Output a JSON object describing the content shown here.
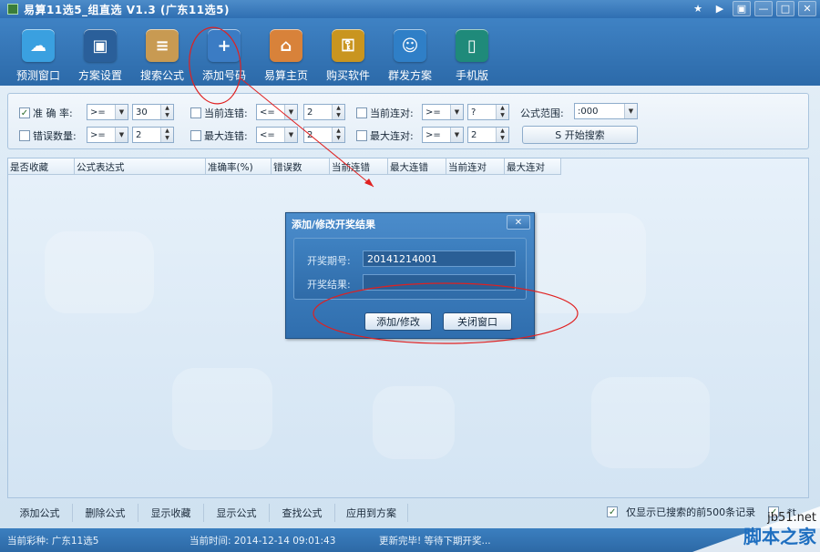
{
  "window": {
    "title": "易算11选5_组直选 V1.3 (广东11选5)",
    "accent": "#2f6fb2"
  },
  "window_controls": [
    "★",
    "▶",
    "▣",
    "—",
    "□",
    "✕"
  ],
  "toolbar": {
    "items": [
      {
        "label": "预测窗口",
        "icon": "cloud-icon",
        "color": "#3aa0e0",
        "glyph": "☁"
      },
      {
        "label": "方案设置",
        "icon": "monitor-icon",
        "color": "#2a5f9a",
        "glyph": "▣"
      },
      {
        "label": "搜索公式",
        "icon": "document-search-icon",
        "color": "#c89a52",
        "glyph": "≡"
      },
      {
        "label": "添加号码",
        "icon": "folder-plus-icon",
        "color": "#3b7cc4",
        "glyph": "+"
      },
      {
        "label": "易算主页",
        "icon": "house-icon",
        "color": "#d8823a",
        "glyph": "⌂"
      },
      {
        "label": "购买软件",
        "icon": "key-icon",
        "color": "#c9951f",
        "glyph": "⚿"
      },
      {
        "label": "群发方案",
        "icon": "users-icon",
        "color": "#2f7fc7",
        "glyph": "☺"
      },
      {
        "label": "手机版",
        "icon": "phone-icon",
        "color": "#1f8a7a",
        "glyph": "▯"
      }
    ]
  },
  "filters": {
    "accuracy": {
      "label": "准 确 率:",
      "checked": true,
      "op": ">=",
      "value": "30"
    },
    "error_count": {
      "label": "错误数量:",
      "checked": false,
      "op": ">=",
      "value": "2"
    },
    "current_miss": {
      "label": "当前连错:",
      "checked": false,
      "op": "<=",
      "value": "2"
    },
    "max_miss": {
      "label": "最大连错:",
      "checked": false,
      "op": "<=",
      "value": "2"
    },
    "current_hit": {
      "label": "当前连对:",
      "checked": false,
      "op": ">=",
      "value": "?"
    },
    "max_hit": {
      "label": "最大连对:",
      "checked": false,
      "op": ">=",
      "value": "2"
    },
    "range_label": "公式范围:",
    "range_value": ":000",
    "search_button": "S 开始搜索"
  },
  "grid": {
    "columns": [
      "是否收藏",
      "公式表达式",
      "准确率(%)",
      "错误数",
      "当前连错",
      "最大连错",
      "当前连对",
      "最大连对"
    ]
  },
  "actions": {
    "buttons": [
      "添加公式",
      "删除公式",
      "显示收藏",
      "显示公式",
      "查找公式",
      "应用到方案"
    ],
    "option1": "仅显示已搜索的前500条记录",
    "option2": "*t"
  },
  "status": {
    "lottery": "当前彩种: 广东11选5",
    "time": "当前时间: 2014-12-14 09:01:43",
    "message": "更新完毕! 等待下期开奖..."
  },
  "dialog": {
    "title": "添加/修改开奖结果",
    "close": "✕",
    "period_label": "开奖期号:",
    "period_value": "20141214001",
    "result_label": "开奖结果:",
    "result_value": "",
    "add_button": "添加/修改",
    "close_button": "关闭窗口"
  },
  "watermark": {
    "url": "jb51.net",
    "text": "脚本之家"
  }
}
